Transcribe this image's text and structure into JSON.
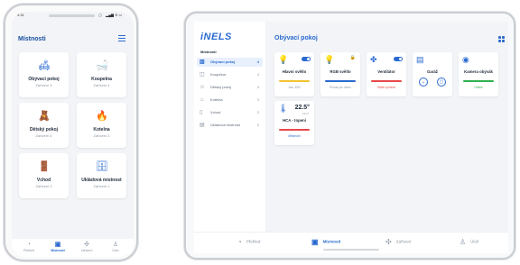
{
  "phone": {
    "status_time": "9:31",
    "status_icons": "▂▄▆ ≋ ▭",
    "title": "Místnosti",
    "rooms": [
      {
        "name": "Obývací pokoj",
        "sub": "Zařízení 3",
        "icon": "sofa-icon",
        "glyph": "🛋"
      },
      {
        "name": "Koupelna",
        "sub": "Zařízení 4",
        "icon": "bath-icon",
        "glyph": "🛁"
      },
      {
        "name": "Dětský pokoj",
        "sub": "Zařízení 4",
        "icon": "teddy-icon",
        "glyph": "🧸"
      },
      {
        "name": "Kotelna",
        "sub": "Zařízení 2",
        "icon": "flame-icon",
        "glyph": "🔥"
      },
      {
        "name": "Vchod",
        "sub": "Zařízení 3",
        "icon": "door-icon",
        "glyph": "🚪"
      },
      {
        "name": "Ukládová místnost",
        "sub": "Zařízení 1",
        "icon": "storage-icon",
        "glyph": "🗄"
      }
    ],
    "nav": [
      {
        "label": "Přehled",
        "glyph": "◔",
        "icon": "dashboard-icon"
      },
      {
        "label": "Místnosti",
        "glyph": "▣",
        "icon": "rooms-icon"
      },
      {
        "label": "Zařízení",
        "glyph": "✣",
        "icon": "devices-icon"
      },
      {
        "label": "Úloh",
        "glyph": "♙",
        "icon": "user-icon"
      }
    ]
  },
  "tablet": {
    "logo": "iNELS",
    "section": "Místnosti",
    "rooms": [
      {
        "label": "Obývací pokoj",
        "count": "4",
        "glyph": "▥",
        "icon": "sofa-icon"
      },
      {
        "label": "Koupelna",
        "count": "4",
        "glyph": "◫",
        "icon": "bath-icon"
      },
      {
        "label": "Dětský pokoj",
        "count": "4",
        "glyph": "☺",
        "icon": "teddy-icon"
      },
      {
        "label": "Kotelna",
        "count": "3",
        "glyph": "♨",
        "icon": "flame-icon"
      },
      {
        "label": "Vchod",
        "count": "2",
        "glyph": "▯",
        "icon": "door-icon"
      },
      {
        "label": "Ukládová místnost",
        "count": "2",
        "glyph": "▤",
        "icon": "storage-icon"
      }
    ],
    "page_title": "Obývací pokoj",
    "devices": [
      {
        "name": "Hlavní světlo",
        "status": "Jas: 30%",
        "bar_color": "#f2c230",
        "glyph": "💡",
        "icon": "lamp-icon"
      },
      {
        "name": "RGB světlo",
        "status": "Plnost pro všem",
        "bar_color": "#2a6ad0",
        "glyph": "💡",
        "icon": "bulb-icon"
      },
      {
        "name": "Ventilátor",
        "status": "Stálé rychlost",
        "bar_color": "#e8484a",
        "glyph": "✤",
        "icon": "fan-icon"
      },
      {
        "name": "Garáž",
        "status": "",
        "bar_color": "",
        "glyph": "▤",
        "icon": "garage-icon"
      },
      {
        "name": "Kamera obývák",
        "status": "Online",
        "bar_color": "#2fb14d",
        "glyph": "◉",
        "icon": "camera-icon"
      },
      {
        "name": "HCA - topení",
        "status": "Minimum",
        "bar_color": "#e8484a",
        "glyph": "🌡",
        "icon": "thermostat-icon",
        "temp": "22.5°",
        "temp_sub": "21.0°"
      }
    ],
    "nav": [
      {
        "label": "Přehled",
        "glyph": "◔",
        "icon": "dashboard-icon"
      },
      {
        "label": "Místnosti",
        "glyph": "▣",
        "icon": "rooms-icon"
      },
      {
        "label": "Zařízení",
        "glyph": "✣",
        "icon": "devices-icon"
      },
      {
        "label": "Úloh",
        "glyph": "♙",
        "icon": "user-icon"
      }
    ]
  }
}
